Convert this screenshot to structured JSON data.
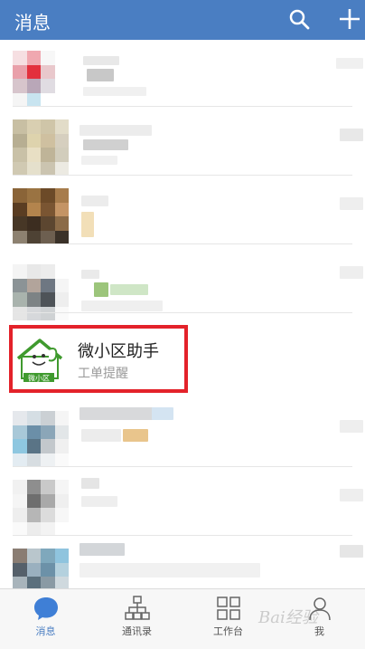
{
  "header": {
    "title": "消息",
    "search_icon": "search-icon",
    "add_icon": "plus-icon",
    "bg_color": "#4a7ec2"
  },
  "highlighted_item": {
    "name": "微小区助手",
    "subtitle": "工单提醒",
    "avatar_text": "微小区",
    "highlight_color": "#e3222a"
  },
  "tabs": [
    {
      "label": "消息",
      "icon": "chat-bubble-icon",
      "active": true
    },
    {
      "label": "通讯录",
      "icon": "org-chart-icon",
      "active": false
    },
    {
      "label": "工作台",
      "icon": "grid-apps-icon",
      "active": false
    },
    {
      "label": "我",
      "icon": "person-icon",
      "active": false
    }
  ],
  "watermark": "Bai经验"
}
